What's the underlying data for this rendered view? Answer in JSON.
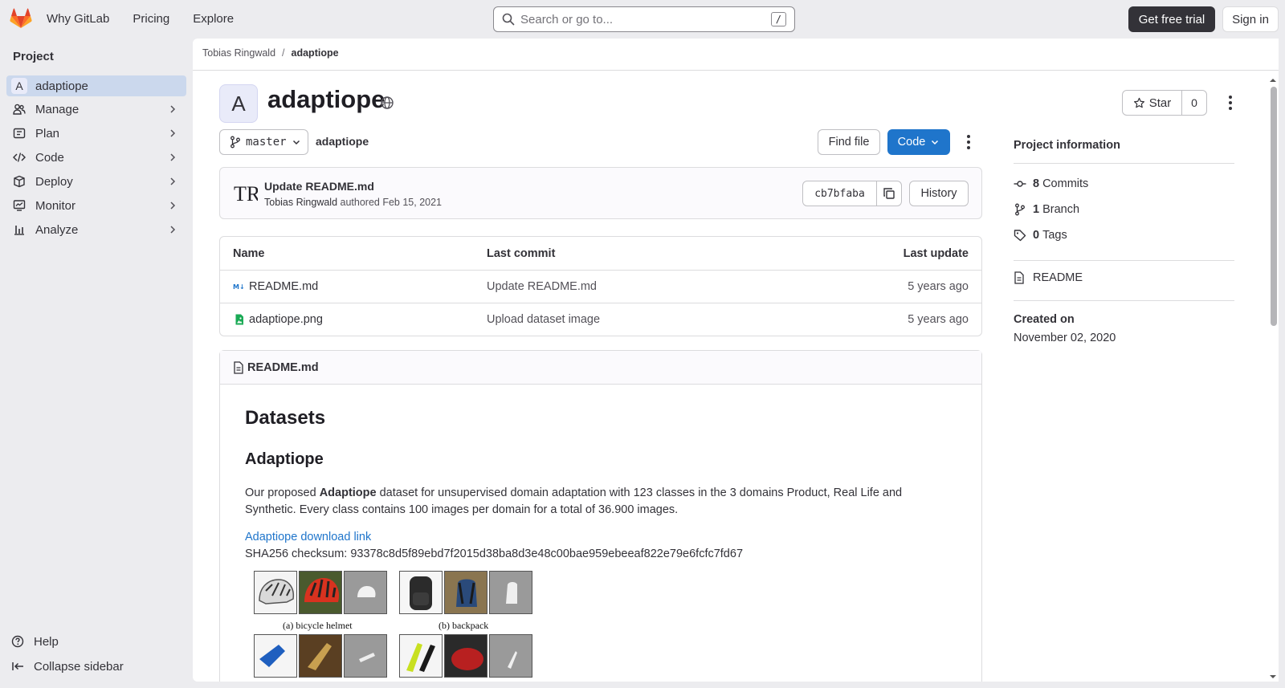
{
  "topnav": {
    "items": [
      "Why GitLab",
      "Pricing",
      "Explore"
    ],
    "search_placeholder": "Search or go to...",
    "search_shortcut": "/",
    "trial_label": "Get free trial",
    "signin_label": "Sign in"
  },
  "sidebar": {
    "title": "Project",
    "project_initial": "A",
    "project_name": "adaptiope",
    "items": [
      "Manage",
      "Plan",
      "Code",
      "Deploy",
      "Monitor",
      "Analyze"
    ],
    "help_label": "Help",
    "collapse_label": "Collapse sidebar"
  },
  "breadcrumb": {
    "owner": "Tobias Ringwald",
    "separator": "/",
    "project": "adaptiope"
  },
  "project": {
    "initial": "A",
    "name": "adaptiope",
    "star_label": "Star",
    "star_count": "0"
  },
  "repo": {
    "branch": "master",
    "path": "adaptiope",
    "find_file_label": "Find file",
    "code_label": "Code"
  },
  "commit": {
    "avatar_text": "TR",
    "message": "Update README.md",
    "author": "Tobias Ringwald",
    "authored_text": "authored Feb 15, 2021",
    "sha": "cb7bfaba",
    "history_label": "History"
  },
  "files": {
    "headers": [
      "Name",
      "Last commit",
      "Last update"
    ],
    "rows": [
      {
        "name": "README.md",
        "commit": "Update README.md",
        "updated": "5 years ago",
        "icon": "markdown-file-icon"
      },
      {
        "name": "adaptiope.png",
        "commit": "Upload dataset image",
        "updated": "5 years ago",
        "icon": "image-file-icon"
      }
    ]
  },
  "readme": {
    "filename": "README.md",
    "h1": "Datasets",
    "h2": "Adaptiope",
    "p_before": "Our proposed ",
    "p_bold": "Adaptiope",
    "p_after": " dataset for unsupervised domain adaptation with 123 classes in the 3 domains Product, Real Life and Synthetic. Every class contains 100 images per domain for a total of 36.900 images.",
    "download_link": "Adaptiope download link",
    "checksum": "SHA256 checksum: 93378c8d5f89ebd7f2015d38ba8d3e48c00bae959ebeeaf822e79e6fcfc7fd67",
    "figure_captions": [
      "(a) bicycle helmet",
      "(b) backpack"
    ]
  },
  "project_info": {
    "title": "Project information",
    "commits_count": "8",
    "commits_label": "Commits",
    "branch_count": "1",
    "branch_label": "Branch",
    "tags_count": "0",
    "tags_label": "Tags",
    "readme_label": "README",
    "created_label": "Created on",
    "created_value": "November 02, 2020"
  },
  "colors": {
    "accent": "#1f75cb",
    "sidebar_active": "#cbd8ed",
    "page_bg": "#ececef"
  }
}
